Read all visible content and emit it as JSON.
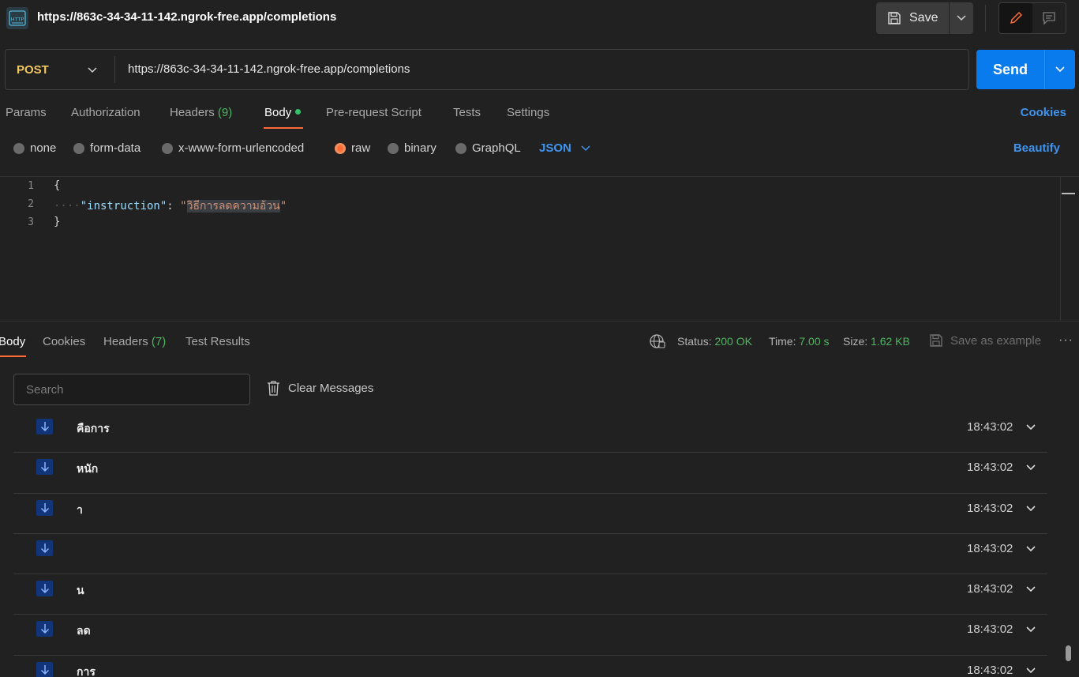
{
  "titlebar": {
    "icon_name": "http-icon",
    "title": "https://863c-34-34-11-142.ngrok-free.app/completions",
    "save_label": "Save"
  },
  "request": {
    "method": "POST",
    "url": "https://863c-34-34-11-142.ngrok-free.app/completions",
    "send_label": "Send",
    "method_color": "#f2c661",
    "send_color": "#097bed"
  },
  "tabs": {
    "params": "Params",
    "authorization": "Authorization",
    "headers": "Headers",
    "headers_count": "(9)",
    "body": "Body",
    "prerequest": "Pre-request Script",
    "tests": "Tests",
    "settings": "Settings",
    "cookies": "Cookies"
  },
  "body_types": {
    "none": "none",
    "form_data": "form-data",
    "urlencoded": "x-www-form-urlencoded",
    "raw": "raw",
    "binary": "binary",
    "graphql": "GraphQL",
    "selected": "raw",
    "format": "JSON",
    "beautify": "Beautify"
  },
  "editor": {
    "lines": [
      "1",
      "2",
      "3"
    ],
    "open_brace": "{",
    "indent": "····",
    "key": "\"instruction\"",
    "colon": ": ",
    "quote": "\"",
    "value": "วิธีการลดความอ้วน",
    "close_brace": "}"
  },
  "response": {
    "tabs": {
      "body": "Body",
      "cookies": "Cookies",
      "headers": "Headers",
      "headers_count": "(7)",
      "test_results": "Test Results"
    },
    "status_label": "Status:",
    "status_value": "200 OK",
    "time_label": "Time:",
    "time_value": "7.00 s",
    "size_label": "Size:",
    "size_value": "1.62 KB",
    "save_example": "Save as example",
    "more": "···",
    "search_placeholder": "Search",
    "clear_messages": "Clear Messages",
    "messages": [
      {
        "text": "คือการ",
        "time": "18:43:02"
      },
      {
        "text": "หนัก",
        "time": "18:43:02"
      },
      {
        "text": "า",
        "time": "18:43:02"
      },
      {
        "text": "",
        "time": "18:43:02"
      },
      {
        "text": "น",
        "time": "18:43:02"
      },
      {
        "text": "ลด",
        "time": "18:43:02"
      },
      {
        "text": "การ",
        "time": "18:43:02"
      }
    ]
  }
}
